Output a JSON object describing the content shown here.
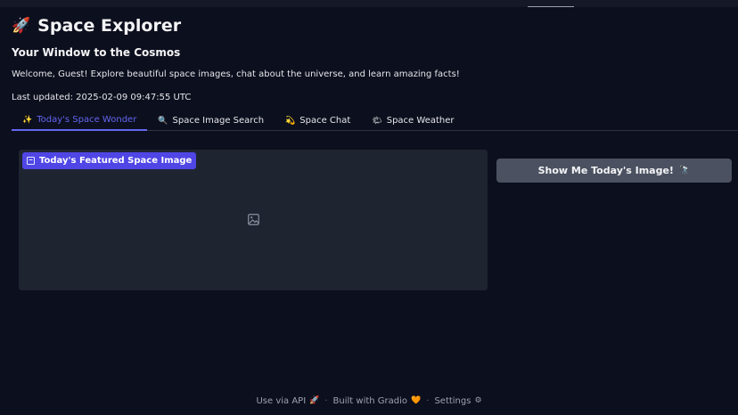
{
  "app": {
    "title": "Space Explorer",
    "title_icon": "🚀",
    "subtitle": "Your Window to the Cosmos",
    "welcome": "Welcome, Guest! Explore beautiful space images, chat about the universe, and learn amazing facts!",
    "last_updated": "Last updated: 2025-02-09 09:47:55 UTC"
  },
  "tabs": [
    {
      "label": "Today's Space Wonder",
      "icon": "✨",
      "active": true
    },
    {
      "label": "Space Image Search",
      "icon": "🔍",
      "active": false
    },
    {
      "label": "Space Chat",
      "icon": "💫",
      "active": false
    },
    {
      "label": "Space Weather",
      "icon": "🌤",
      "active": false
    }
  ],
  "image_panel": {
    "label": "Today's Featured Space Image",
    "label_icon": "image-icon",
    "placeholder_icon": "image-placeholder-icon"
  },
  "show_button": {
    "label": "Show Me Today's Image!",
    "icon": "🔭"
  },
  "footer": {
    "api_label": "Use via API",
    "api_icon": "🚀",
    "built_label": "Built with Gradio",
    "built_icon": "🧡",
    "separator": "·",
    "settings_label": "Settings",
    "settings_icon": "⚙"
  },
  "colors": {
    "background": "#0c0f1d",
    "accent": "#6366f1",
    "label_bg": "#4f46e5",
    "panel_bg": "#1f2431",
    "button_bg": "#4b5160"
  }
}
